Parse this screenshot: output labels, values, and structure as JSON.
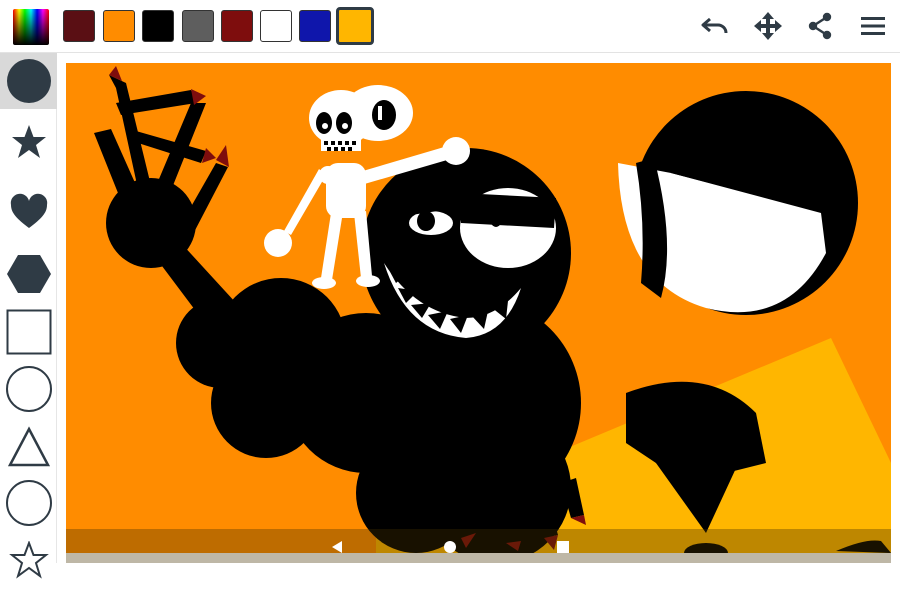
{
  "palette": {
    "colors": [
      "#5a0f14",
      "#ff8c00",
      "#000000",
      "#5e5e5e",
      "#7e0d0d",
      "#ffffff",
      "#0f16ab",
      "#ffb600"
    ],
    "selected_index": 7
  },
  "toolbar": {
    "icons": [
      "undo-icon",
      "move-icon",
      "share-icon",
      "menu-icon"
    ]
  },
  "shapes": {
    "items": [
      "circle-filled",
      "star-filled",
      "heart-filled",
      "hexagon-filled",
      "square-outline",
      "circle-outline",
      "triangle-outline",
      "circle-outline",
      "star-outline"
    ],
    "active_index": 0,
    "accent": "#2f3b45"
  },
  "canvas": {
    "background": "#ff8c00"
  },
  "navigation": {
    "icons": [
      "back-icon",
      "home-icon",
      "recents-icon"
    ]
  }
}
